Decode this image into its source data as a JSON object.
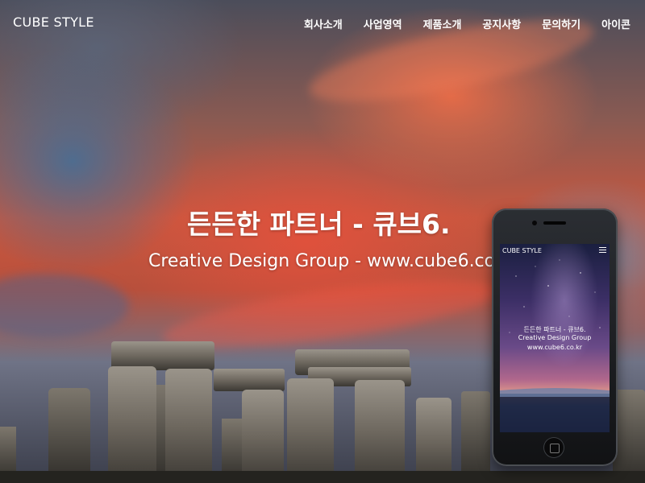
{
  "header": {
    "brand": "CUBE STYLE",
    "nav": [
      "회사소개",
      "사업영역",
      "제품소개",
      "공지사항",
      "문의하기",
      "아이콘"
    ]
  },
  "hero": {
    "headline": "든든한 파트너 - 큐브6.",
    "subline": "Creative Design Group - www.cube6.co.kr"
  },
  "mobile": {
    "brand": "CUBE STYLE",
    "headline": "든든한 파트너 - 큐브6.",
    "line2": "Creative Design Group",
    "line3": "www.cube6.co.kr",
    "menu_icon": "hamburger-icon"
  },
  "colors": {
    "sky_red": "#c9573f",
    "sky_blue": "#466e96",
    "text": "#ffffff",
    "phone_body": "#1a1c1f"
  }
}
